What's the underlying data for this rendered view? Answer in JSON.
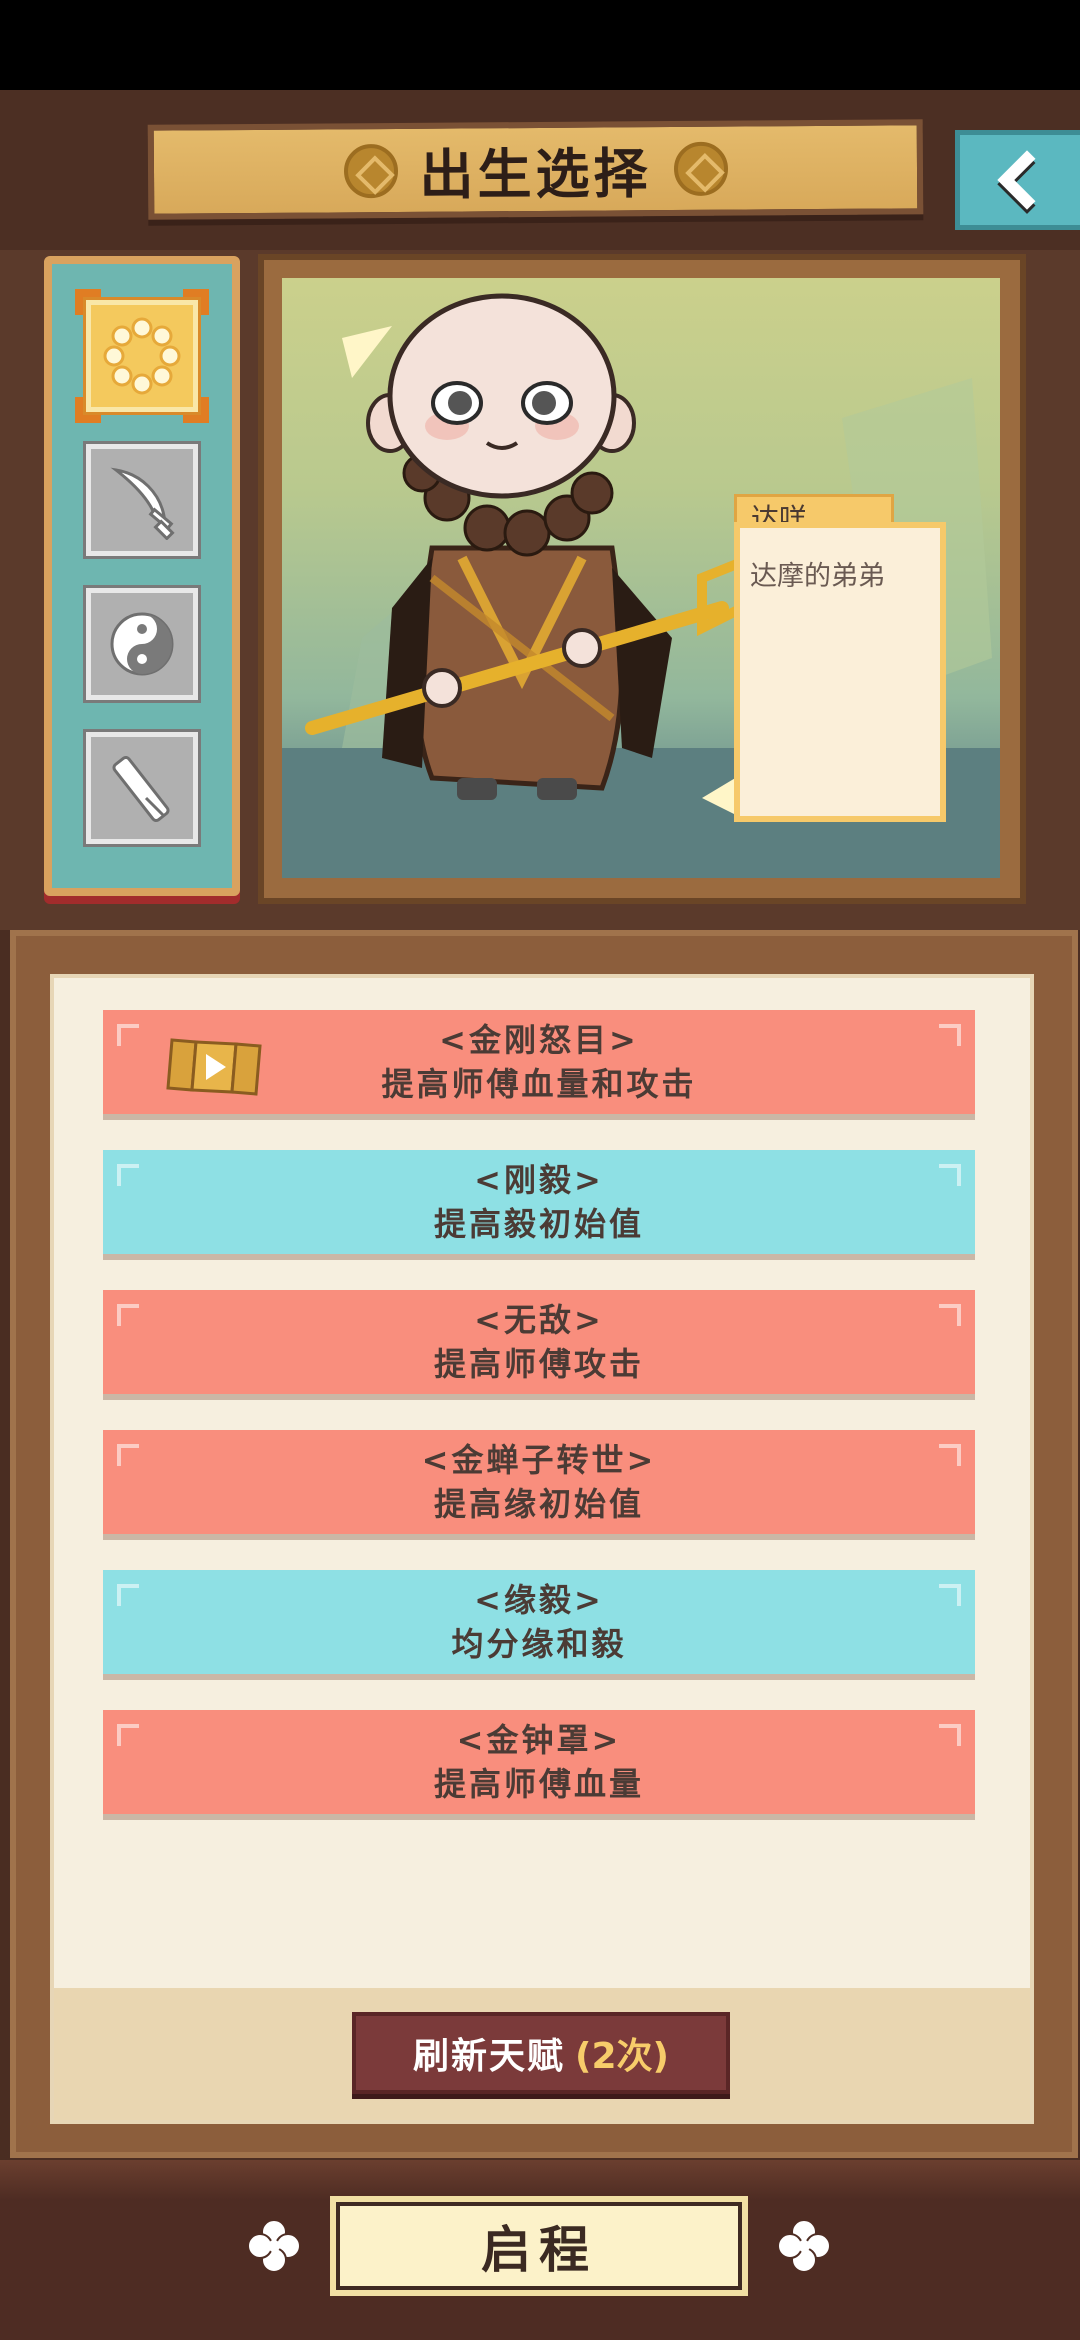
{
  "header": {
    "title": "出生选择"
  },
  "character": {
    "name": "达咩",
    "description": "达摩的弟弟"
  },
  "side_tabs": [
    {
      "icon": "prayer-beads-icon",
      "active": true
    },
    {
      "icon": "sword-icon",
      "active": false
    },
    {
      "icon": "yin-yang-icon",
      "active": false
    },
    {
      "icon": "scroll-brush-icon",
      "active": false
    }
  ],
  "talents": [
    {
      "name": "<金刚怒目>",
      "desc": "提高师傅血量和攻击",
      "color": "red",
      "has_video": true
    },
    {
      "name": "<刚毅>",
      "desc": "提高毅初始值",
      "color": "blue",
      "has_video": false
    },
    {
      "name": "<无敌>",
      "desc": "提高师傅攻击",
      "color": "red",
      "has_video": false
    },
    {
      "name": "<金蝉子转世>",
      "desc": "提高缘初始值",
      "color": "red",
      "has_video": false
    },
    {
      "name": "<缘毅>",
      "desc": "均分缘和毅",
      "color": "blue",
      "has_video": false
    },
    {
      "name": "<金钟罩>",
      "desc": "提高师傅血量",
      "color": "red",
      "has_video": false
    }
  ],
  "refresh": {
    "label": "刷新天赋",
    "count": "(2次)"
  },
  "start": {
    "label": "启程"
  },
  "colors": {
    "talent_red": "#f98e7d",
    "talent_blue": "#8ee0e4",
    "accent_gold": "#f6c96a",
    "refresh_button": "#7b3a3a"
  }
}
